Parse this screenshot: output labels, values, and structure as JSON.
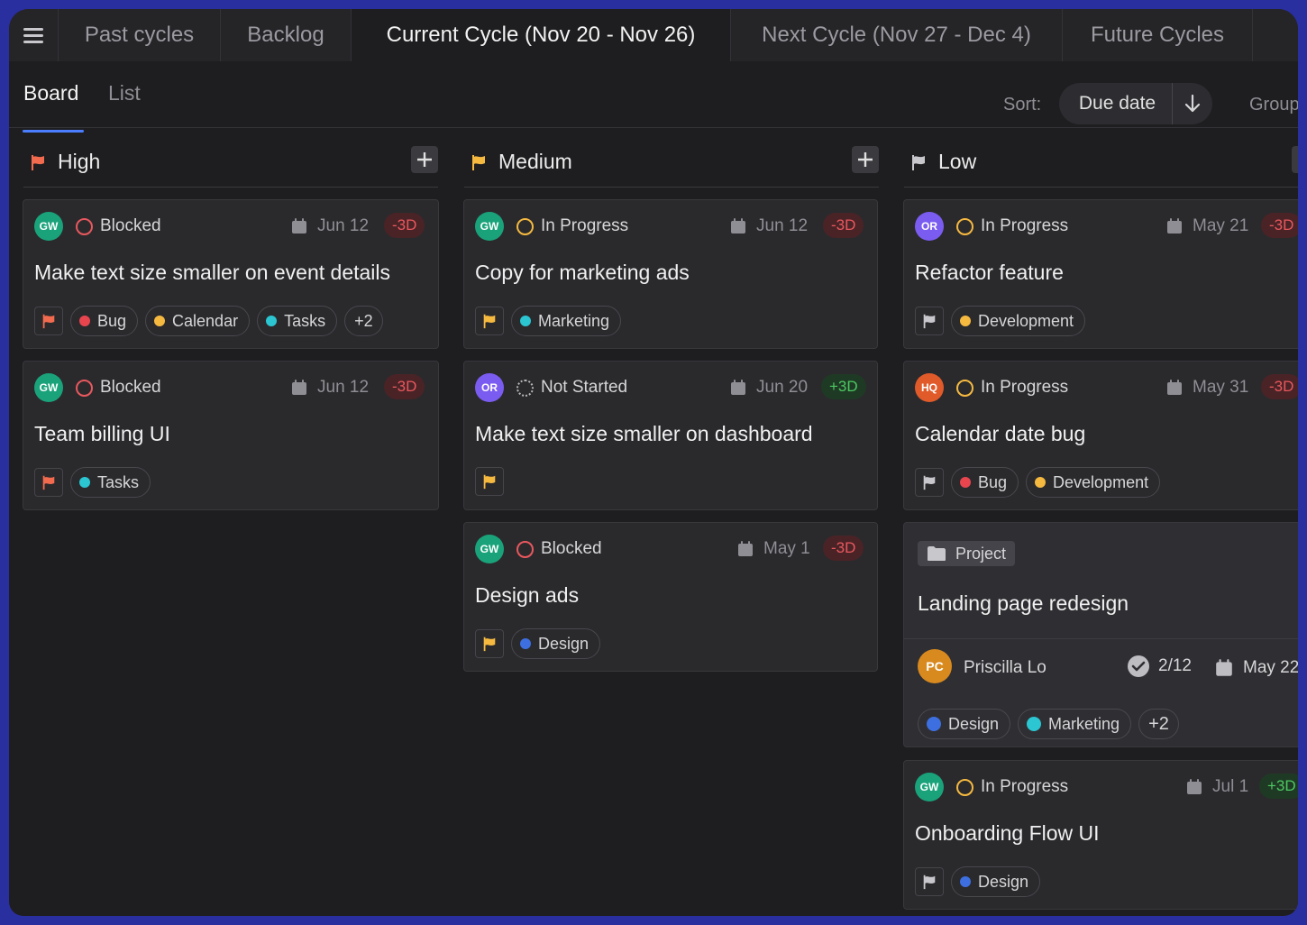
{
  "tabs": [
    "Past cycles",
    "Backlog",
    "Current Cycle (Nov 20 - Nov 26)",
    "Next Cycle (Nov 27 - Dec 4)",
    "Future Cycles"
  ],
  "view": {
    "board": "Board",
    "list": "List"
  },
  "sort": {
    "label": "Sort:",
    "value": "Due date",
    "group_label": "Group"
  },
  "columns": {
    "high": {
      "title": "High",
      "flag_color": "#f26b4f"
    },
    "medium": {
      "title": "Medium",
      "flag_color": "#f5b940"
    },
    "low": {
      "title": "Low",
      "flag_color": "#c8c8cc"
    }
  },
  "colors": {
    "blocked": "#e8585e",
    "in_progress": "#f5b940",
    "bug": "#e8454f",
    "calendar": "#f5b940",
    "tasks": "#2bc6d2",
    "marketing": "#2bc6d2",
    "development": "#f5b940",
    "design": "#3d6fe0",
    "gw": "#1aa37a",
    "or": "#7b5cf0",
    "hq": "#e05a2a",
    "pc": "#d98a1e"
  },
  "cards": {
    "h1": {
      "avatar": "GW",
      "status": "Blocked",
      "date": "Jun 12",
      "badge": "-3D",
      "title": "Make text size smaller on event details",
      "tags": [
        "Bug",
        "Calendar",
        "Tasks"
      ],
      "more": "+2"
    },
    "h2": {
      "avatar": "GW",
      "status": "Blocked",
      "date": "Jun 12",
      "badge": "-3D",
      "title": "Team billing UI",
      "tags": [
        "Tasks"
      ]
    },
    "m1": {
      "avatar": "GW",
      "status": "In Progress",
      "date": "Jun 12",
      "badge": "-3D",
      "title": "Copy for marketing ads",
      "tags": [
        "Marketing"
      ]
    },
    "m2": {
      "avatar": "OR",
      "status": "Not Started",
      "date": "Jun 20",
      "badge": "+3D",
      "title": "Make text size smaller on dashboard"
    },
    "m3": {
      "avatar": "GW",
      "status": "Blocked",
      "date": "May 1",
      "badge": "-3D",
      "title": "Design ads",
      "tags": [
        "Design"
      ]
    },
    "l1": {
      "avatar": "OR",
      "status": "In Progress",
      "date": "May 21",
      "badge": "-3D",
      "title": "Refactor feature",
      "tags": [
        "Development"
      ]
    },
    "l2": {
      "avatar": "HQ",
      "status": "In Progress",
      "date": "May 31",
      "badge": "-3D",
      "title": "Calendar date bug",
      "tags": [
        "Bug",
        "Development"
      ]
    },
    "l3": {
      "kind": "Project",
      "title": "Landing page redesign",
      "owner_initials": "PC",
      "owner": "Priscilla Lo",
      "progress": "2/12",
      "date": "May 22",
      "tags": [
        "Design",
        "Marketing"
      ],
      "more": "+2"
    },
    "l4": {
      "avatar": "GW",
      "status": "In Progress",
      "date": "Jul 1",
      "badge": "+3D",
      "title": "Onboarding Flow UI",
      "tags": [
        "Design"
      ]
    }
  }
}
